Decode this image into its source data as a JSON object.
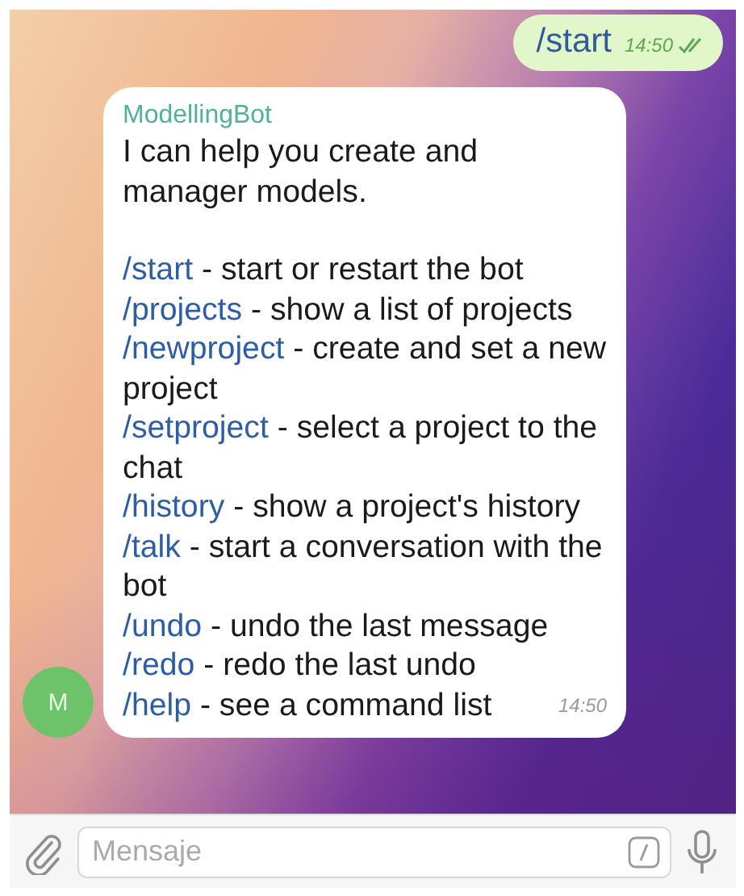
{
  "chat": {
    "messages": [
      {
        "kind": "outgoing",
        "text": "/start",
        "time": "14:50",
        "read": true
      },
      {
        "kind": "incoming",
        "sender": "ModellingBot",
        "intro": "I can help you create and manager models.",
        "commands": [
          {
            "command": "/start",
            "description": " - start or restart the bot"
          },
          {
            "command": "/projects",
            "description": " - show a list of projects"
          },
          {
            "command": "/newproject",
            "description": " - create and set a new project"
          },
          {
            "command": "/setproject",
            "description": " - select a project to the chat"
          },
          {
            "command": "/history",
            "description": " - show a project's history"
          },
          {
            "command": "/talk",
            "description": " - start a conversation with the bot"
          },
          {
            "command": "/undo",
            "description": " - undo the last message"
          },
          {
            "command": "/redo",
            "description": " - redo the last undo"
          },
          {
            "command": "/help",
            "description": " - see a command list"
          }
        ],
        "time": "14:50",
        "avatar": "M"
      }
    ]
  },
  "composer": {
    "placeholder": "Mensaje"
  }
}
